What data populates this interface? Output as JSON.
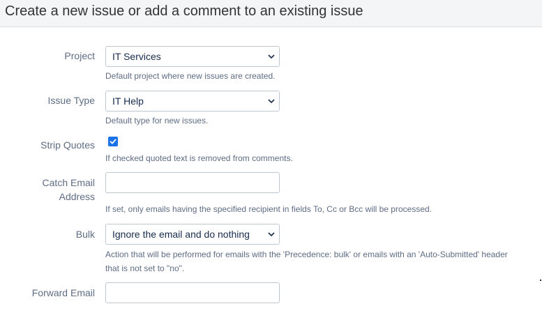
{
  "header": {
    "title": "Create a new issue or add a comment to an existing issue"
  },
  "form": {
    "project": {
      "label": "Project",
      "value": "IT Services",
      "description": "Default project where new issues are created."
    },
    "issue_type": {
      "label": "Issue Type",
      "value": "IT Help",
      "description": "Default type for new issues."
    },
    "strip_quotes": {
      "label": "Strip Quotes",
      "checked": true,
      "description": "If checked quoted text is removed from comments."
    },
    "catch_email": {
      "label_line1": "Catch Email",
      "label_line2": "Address",
      "value": "",
      "description": "If set, only emails having the specified recipient in fields To, Cc or Bcc will be processed."
    },
    "bulk": {
      "label": "Bulk",
      "value": "Ignore the email and do nothing",
      "description_line1": "Action that will be performed for emails with the 'Precedence: bulk' or emails with an 'Auto-Submitted' header",
      "description_line2": "that is not set to \"no\"."
    },
    "forward_email": {
      "label": "Forward Email",
      "value": ""
    }
  },
  "colors": {
    "checkbox_accent": "#1a73e8",
    "label_text": "#5e6c84",
    "header_bg": "#f4f5f7"
  },
  "icons": {
    "select_chevron": "chevron-down-icon",
    "checkbox_check": "check-icon"
  }
}
